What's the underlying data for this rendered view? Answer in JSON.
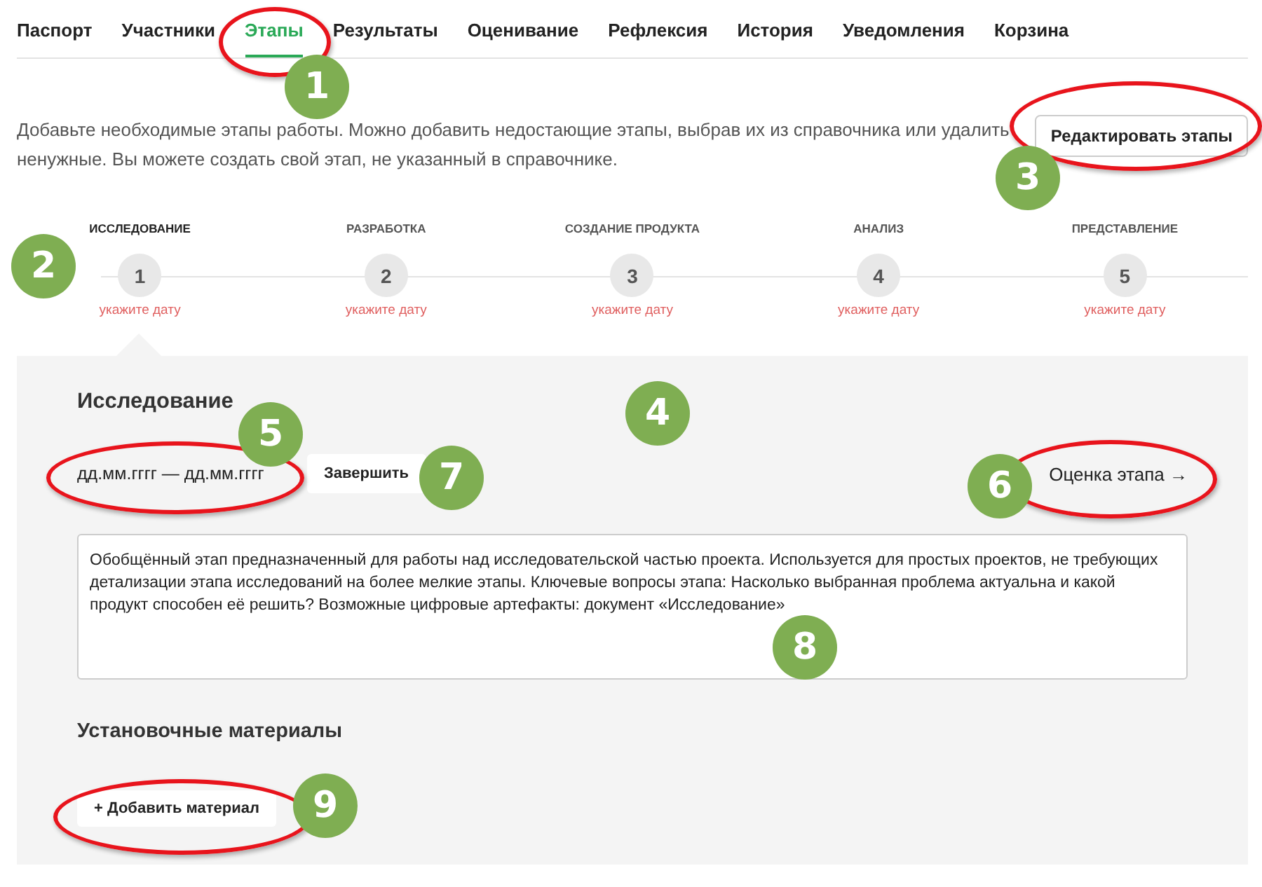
{
  "tabs": [
    {
      "label": "Паспорт",
      "selected": false
    },
    {
      "label": "Участники",
      "selected": false
    },
    {
      "label": "Этапы",
      "selected": true
    },
    {
      "label": "Результаты",
      "selected": false
    },
    {
      "label": "Оценивание",
      "selected": false
    },
    {
      "label": "Рефлексия",
      "selected": false
    },
    {
      "label": "История",
      "selected": false
    },
    {
      "label": "Уведомления",
      "selected": false
    },
    {
      "label": "Корзина",
      "selected": false
    }
  ],
  "intro": "Добавьте необходимые этапы работы. Можно добавить недостающие этапы, выбрав их из справочника или удалить ненужные. Вы можете создать свой этап, не указанный в справочнике.",
  "edit_button": "Редактировать этапы",
  "steps": [
    {
      "label": "ИССЛЕДОВАНИЕ",
      "number": "1",
      "date": "укажите дату",
      "selected": true
    },
    {
      "label": "РАЗРАБОТКА",
      "number": "2",
      "date": "укажите дату",
      "selected": false
    },
    {
      "label": "СОЗДАНИЕ ПРОДУКТА",
      "number": "3",
      "date": "укажите дату",
      "selected": false
    },
    {
      "label": "АНАЛИЗ",
      "number": "4",
      "date": "укажите дату",
      "selected": false
    },
    {
      "label": "ПРЕДСТАВЛЕНИЕ",
      "number": "5",
      "date": "укажите дату",
      "selected": false
    }
  ],
  "stage": {
    "title": "Исследование",
    "dates": "дд.мм.гггг — дд.мм.гггг",
    "finish_button": "Завершить",
    "assessment_link": "Оценка этапа →",
    "description": "Обобщённый этап предназначенный для работы над исследовательской частью проекта. Используется для простых проектов, не требующих детализации этапа исследований на более мелкие этапы. Ключевые вопросы этапа: Насколько выбранная проблема актуальна и какой продукт способен её решить? Возможные цифровые артефакты: документ «Исследование»",
    "materials_title": "Установочные материалы",
    "add_material_button": "+ Добавить материал"
  },
  "annotations": [
    {
      "number": "1",
      "circled": true
    },
    {
      "number": "2",
      "circled": false
    },
    {
      "number": "3",
      "circled": true
    },
    {
      "number": "4",
      "circled": false
    },
    {
      "number": "5",
      "circled": true
    },
    {
      "number": "6",
      "circled": true
    },
    {
      "number": "7",
      "circled": false
    },
    {
      "number": "8",
      "circled": false
    },
    {
      "number": "9",
      "circled": true
    }
  ]
}
